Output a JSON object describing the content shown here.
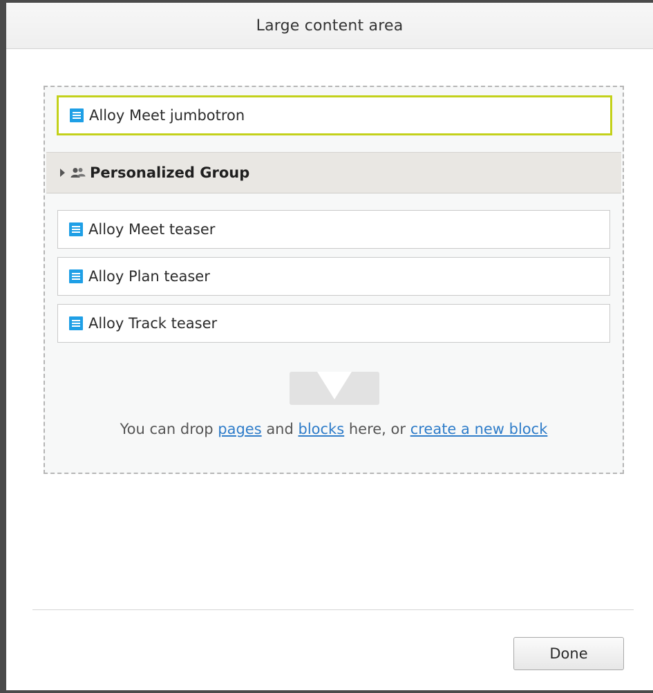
{
  "dialog": {
    "title": "Large content area",
    "done_label": "Done"
  },
  "content_area": {
    "items": [
      {
        "label": "Alloy Meet jumbotron",
        "icon": "block-icon",
        "selected": true
      }
    ],
    "group": {
      "label": "Personalized Group",
      "icon": "users-icon",
      "expand_icon": "caret-right-icon"
    },
    "group_items": [
      {
        "label": "Alloy Meet teaser",
        "icon": "block-icon"
      },
      {
        "label": "Alloy Plan teaser",
        "icon": "block-icon"
      },
      {
        "label": "Alloy Track teaser",
        "icon": "block-icon"
      }
    ],
    "dropzone": {
      "icon": "drop-arrow-icon",
      "text_before": "You can drop ",
      "link_pages": "pages",
      "text_and": " and ",
      "link_blocks": "blocks",
      "text_here": " here, or ",
      "link_create": "create a new block"
    }
  },
  "colors": {
    "selected_border": "#c3d11a",
    "block_icon": "#1e9fe6",
    "link": "#2e7cc9",
    "group_bg": "#e9e7e3"
  }
}
